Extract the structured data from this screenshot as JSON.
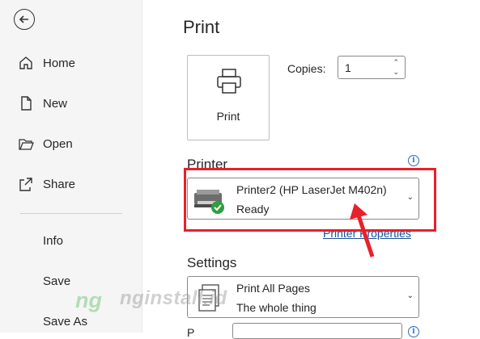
{
  "sidebar": {
    "items": [
      {
        "label": "Home",
        "icon": "home-icon"
      },
      {
        "label": "New",
        "icon": "new-document-icon"
      },
      {
        "label": "Open",
        "icon": "folder-open-icon"
      },
      {
        "label": "Share",
        "icon": "share-icon"
      },
      {
        "label": "Info"
      },
      {
        "label": "Save"
      },
      {
        "label": "Save As"
      }
    ]
  },
  "main": {
    "title": "Print",
    "print_button_label": "Print",
    "copies_label": "Copies:",
    "copies_value": "1",
    "printer_section": "Printer",
    "printer_name": "Printer2 (HP LaserJet M402n)",
    "printer_status": "Ready",
    "printer_properties": "Printer Properties",
    "settings_section": "Settings",
    "settings_primary": "Print All Pages",
    "settings_secondary": "The whole thing",
    "bottom_label": "P"
  },
  "watermark": {
    "text": "nginstall.id",
    "logo": "ng"
  },
  "colors": {
    "highlight": "#e8202a",
    "accent": "#2b6cc4",
    "status_ok": "#2e9e3e"
  }
}
